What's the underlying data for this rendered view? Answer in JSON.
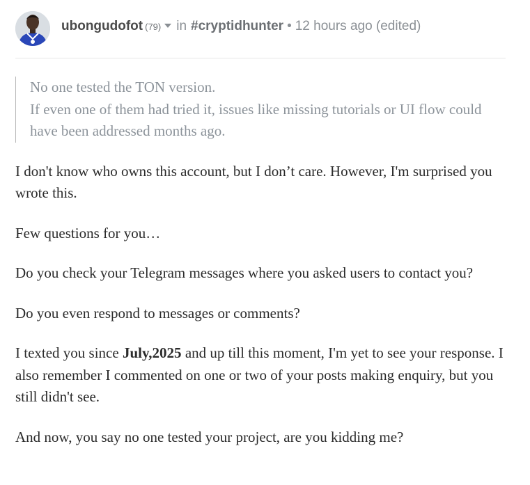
{
  "post": {
    "author": "ubongudofot",
    "reputation": "(79)",
    "in_label": "in",
    "community": "#cryptidhunter",
    "separator": "•",
    "timestamp": "12 hours ago (edited)"
  },
  "blockquote": {
    "lines": [
      "No one tested the TON version.",
      "If even one of them had tried it, issues like missing tutorials or UI flow could have been addressed months ago."
    ]
  },
  "body": {
    "p1": "I don't know who owns this account, but I don’t care. However, I'm surprised you wrote this.",
    "p2": "Few questions for you…",
    "p3": "Do you check your Telegram messages where you asked users to contact you?",
    "p4": "Do you even respond to messages or comments?",
    "p5_before": "I texted you since ",
    "p5_bold": "July,2025",
    "p5_after": " and up till this moment, I'm yet to see your response. I also remember I commented on one or two of your posts making enquiry, but you still didn't see.",
    "p6": "And now, you say no one tested your project, are you kidding me?"
  }
}
